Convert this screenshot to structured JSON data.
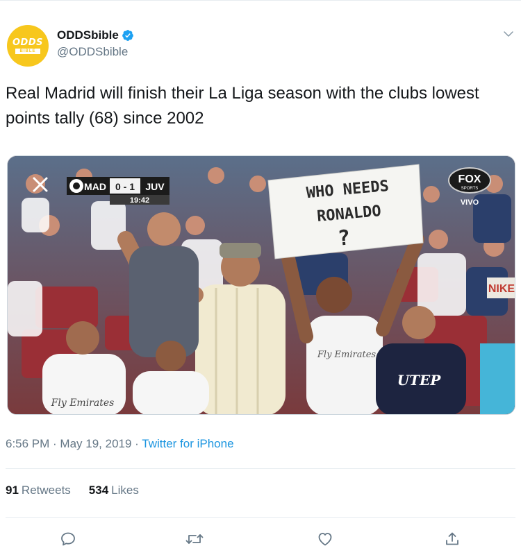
{
  "header": {
    "display_name": "ODDSbible",
    "handle": "@ODDSbible",
    "avatar_logo_top": "ODDS",
    "avatar_logo_bottom": "BIBLE",
    "verified": true
  },
  "tweet": {
    "text": "Real Madrid will finish their La Liga season with the clubs lowest points tally (68) since 2002"
  },
  "media": {
    "scoreboard": {
      "home": "MAD",
      "score": "0 - 1",
      "away": "JUV",
      "clock": "19:42"
    },
    "broadcaster": "FOX",
    "broadcaster_sub": "SPORTS",
    "live_label": "VIVO",
    "sign_line1": "WHO NEEDS",
    "sign_line2": "RONALDO",
    "sign_line3": "?",
    "shirt_text": "Fly Emirates",
    "shirt_text_left": "Fly Emirates",
    "shirt_utep": "UTEP",
    "banner_right": "NIKE"
  },
  "meta": {
    "time": "6:56 PM",
    "separator": " · ",
    "date": "May 19, 2019",
    "source": "Twitter for iPhone"
  },
  "stats": {
    "retweets_count": "91",
    "retweets_label": "Retweets",
    "likes_count": "534",
    "likes_label": "Likes"
  },
  "colors": {
    "accent": "#1b95e0",
    "avatar_bg": "#f7c71d",
    "secondary_text": "#657786"
  },
  "icons": [
    "chevron-down-icon",
    "verified-badge-icon",
    "reply-icon",
    "retweet-icon",
    "like-icon",
    "share-icon",
    "close-icon"
  ]
}
